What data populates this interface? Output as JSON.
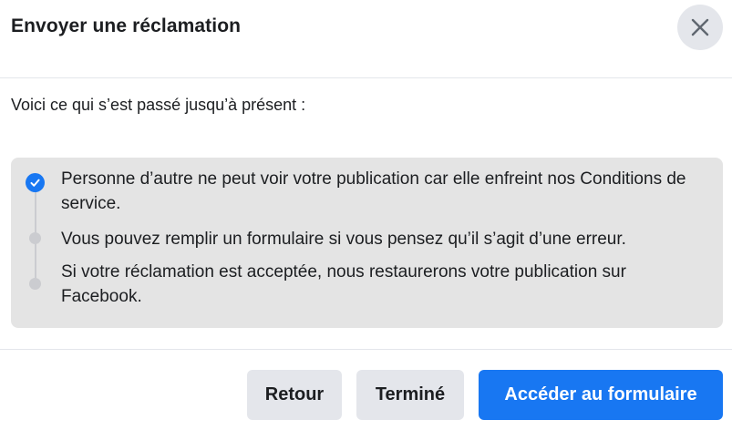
{
  "dialog": {
    "title": "Envoyer une réclamation",
    "close_icon": "close-icon"
  },
  "intro": "Voici ce qui s’est passé jusqu’à présent :",
  "steps": [
    {
      "text": "Personne d’autre ne peut voir votre publication car elle enfreint nos Conditions de service.",
      "status": "completed",
      "icon": "check-icon"
    },
    {
      "text": "Vous pouvez remplir un formulaire si vous pensez qu’il s’agit d’une erreur.",
      "status": "pending",
      "icon": "dot-icon"
    },
    {
      "text": "Si votre réclamation est acceptée, nous restaurerons votre publication sur Facebook.",
      "status": "pending",
      "icon": "dot-icon"
    }
  ],
  "footer": {
    "back_label": "Retour",
    "done_label": "Terminé",
    "form_label": "Accéder au formulaire"
  },
  "colors": {
    "accent": "#1877f2",
    "button_gray": "#e4e6eb",
    "steps_background": "#e4e4e4",
    "pending_dot": "#cbccd0"
  }
}
